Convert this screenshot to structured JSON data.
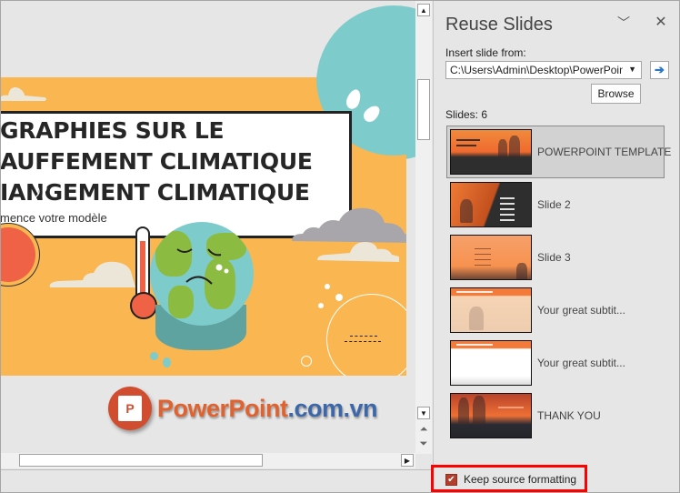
{
  "slide": {
    "title_lines": [
      "GRAPHIES SUR LE",
      "AUFFEMENT CLIMATIQUE",
      "IANGEMENT CLIMATIQUE"
    ],
    "subtitle": "mence votre modèle",
    "colors": {
      "background": "#f9b651",
      "accent_teal": "#7ecbcb",
      "sun": "#ef6245",
      "land": "#8bbc41"
    }
  },
  "watermark": {
    "logo_letter": "P",
    "text_main": "PowerPoint",
    "text_domain": ".com.vn"
  },
  "scrollbar": {
    "up_icon": "▲",
    "down_icon": "▼",
    "prev_slide_icon": "⏶",
    "next_slide_icon": "⏷",
    "right_icon": "▶"
  },
  "pane": {
    "title": "Reuse Slides",
    "collapse_icon": "﹀",
    "close_icon": "✕",
    "insert_label": "Insert slide from:",
    "path_value": "C:\\Users\\Admin\\Desktop\\PowerPoint",
    "dropdown_icon": "▼",
    "go_icon": "➔",
    "browse_label": "Browse",
    "slides_count": "Slides: 6",
    "slides": [
      {
        "name": "POWERPOINT TEMPLATE",
        "selected": true
      },
      {
        "name": "Slide 2",
        "selected": false
      },
      {
        "name": "Slide 3",
        "selected": false
      },
      {
        "name": "Your great subtit...",
        "selected": false
      },
      {
        "name": "Your great subtit...",
        "selected": false
      },
      {
        "name": "THANK YOU",
        "selected": false
      }
    ],
    "keep_source_formatting": {
      "label": "Keep source formatting",
      "checked": true,
      "check_icon": "✔"
    },
    "highlight_color": "#ff0000"
  }
}
